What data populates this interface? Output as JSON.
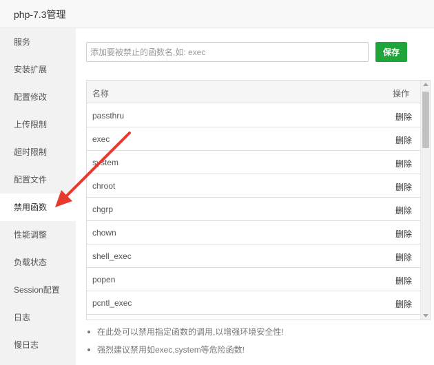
{
  "window": {
    "title": "php-7.3管理"
  },
  "sidebar": {
    "items": [
      {
        "label": "服务"
      },
      {
        "label": "安装扩展"
      },
      {
        "label": "配置修改"
      },
      {
        "label": "上传限制"
      },
      {
        "label": "超时限制"
      },
      {
        "label": "配置文件"
      },
      {
        "label": "禁用函数",
        "active": true
      },
      {
        "label": "性能调整"
      },
      {
        "label": "负载状态"
      },
      {
        "label": "Session配置"
      },
      {
        "label": "日志"
      },
      {
        "label": "慢日志"
      }
    ]
  },
  "form": {
    "input_placeholder": "添加要被禁止的函数名,如: exec",
    "input_value": "",
    "save_label": "保存"
  },
  "table": {
    "headers": {
      "name": "名称",
      "op": "操作"
    },
    "rows": [
      {
        "name": "passthru",
        "op": "删除"
      },
      {
        "name": "exec",
        "op": "删除"
      },
      {
        "name": "system",
        "op": "删除"
      },
      {
        "name": "chroot",
        "op": "删除"
      },
      {
        "name": "chgrp",
        "op": "删除"
      },
      {
        "name": "chown",
        "op": "删除"
      },
      {
        "name": "shell_exec",
        "op": "删除"
      },
      {
        "name": "popen",
        "op": "删除"
      },
      {
        "name": "pcntl_exec",
        "op": "删除"
      }
    ]
  },
  "tips": [
    "在此处可以禁用指定函数的调用,以增强环境安全性!",
    "强烈建议禁用如exec,system等危险函数!"
  ],
  "colors": {
    "accent_green": "#20a53a",
    "annotation_arrow": "#e8392f"
  },
  "icons": {
    "annotation": "arrow-icon",
    "scroll_up": "scroll-up-icon",
    "scroll_down": "scroll-down-icon"
  }
}
